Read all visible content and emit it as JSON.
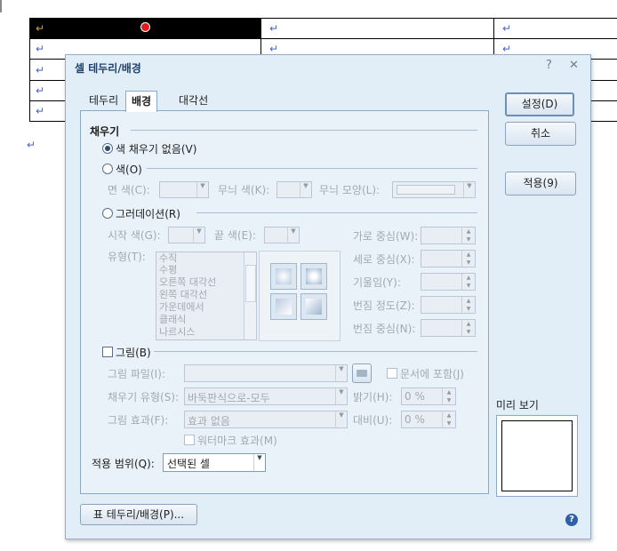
{
  "document": {
    "return_mark": "↵"
  },
  "dialog": {
    "title": "셀 테두리/배경",
    "help_icon": "?",
    "close_icon": "✕",
    "tabs": [
      {
        "label": "테두리"
      },
      {
        "label": "배경"
      },
      {
        "label": "대각선"
      }
    ],
    "fill": {
      "section_label": "채우기",
      "no_color_label": "색 채우기 없음(V)",
      "color_label": "색(O)",
      "face_color_label": "면 색(C):",
      "pattern_color_label": "무늬 색(K):",
      "pattern_shape_label": "무늬 모양(L):",
      "gradation_label": "그러데이션(R)",
      "start_color_label": "시작 색(G):",
      "end_color_label": "끝 색(E):",
      "type_label": "유형(T):",
      "type_options": [
        "수직",
        "수평",
        "오른쪽 대각선",
        "왼쪽 대각선",
        "가운데에서",
        "클래식",
        "나르시스"
      ],
      "h_center_label": "가로 중심(W):",
      "v_center_label": "세로 중심(X):",
      "tilt_label": "기울임(Y):",
      "blur_degree_label": "번짐 정도(Z):",
      "blur_center_label": "번짐 중심(N):",
      "picture_label": "그림(B)",
      "picture_file_label": "그림 파일(I):",
      "include_in_doc_label": "문서에 포함(J)",
      "fill_type_label": "채우기 유형(S):",
      "fill_type_value": "바둑판식으로-모두",
      "brightness_label": "밝기(H):",
      "brightness_value": "0 %",
      "picture_effect_label": "그림 효과(F):",
      "picture_effect_value": "효과 없음",
      "contrast_label": "대비(U):",
      "contrast_value": "0 %",
      "watermark_label": "워터마크 효과(M)"
    },
    "apply_range_label": "적용 범위(Q):",
    "apply_range_value": "선택된 셀",
    "buttons": {
      "ok": "설정(D)",
      "cancel": "취소",
      "apply": "적용(9)",
      "table_border": "표 테두리/배경(P)..."
    },
    "preview_label": "미리 보기",
    "help_button_icon": "?"
  }
}
